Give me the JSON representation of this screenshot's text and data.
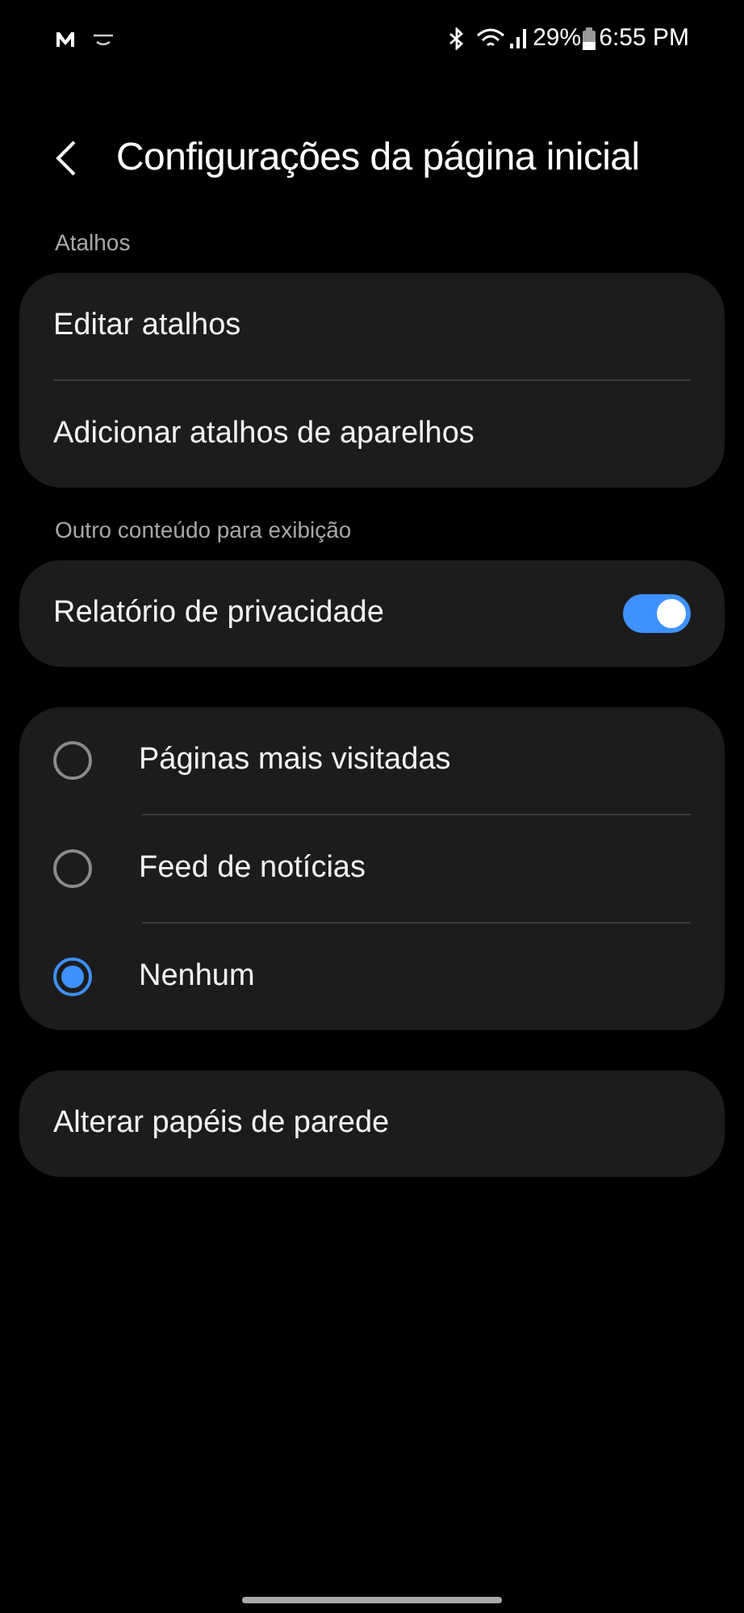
{
  "status_bar": {
    "battery": "29%",
    "time": "6:55 PM"
  },
  "header": {
    "title": "Configurações da página inicial"
  },
  "sections": [
    {
      "label": "Atalhos",
      "cards": [
        {
          "items": [
            {
              "kind": "link",
              "label": "Editar atalhos"
            },
            {
              "kind": "link",
              "label": "Adicionar atalhos de aparelhos"
            }
          ]
        }
      ]
    },
    {
      "label": "Outro conteúdo para exibição",
      "cards": [
        {
          "items": [
            {
              "kind": "switch",
              "label": "Relatório de privacidade",
              "on": true
            }
          ]
        },
        {
          "items": [
            {
              "kind": "radio",
              "label": "Páginas mais visitadas",
              "selected": false
            },
            {
              "kind": "radio",
              "label": "Feed de notícias",
              "selected": false
            },
            {
              "kind": "radio",
              "label": "Nenhum",
              "selected": true
            }
          ]
        },
        {
          "items": [
            {
              "kind": "link",
              "label": "Alterar papéis de parede"
            }
          ]
        }
      ]
    }
  ]
}
